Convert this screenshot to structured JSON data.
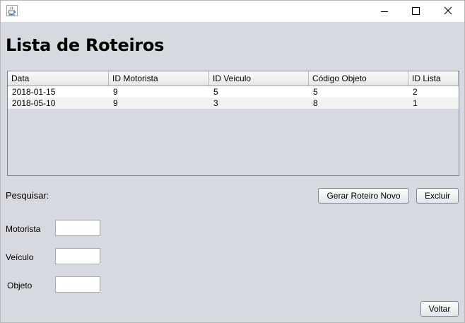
{
  "window": {
    "title": "",
    "app_icon": "java-coffee-cup-icon",
    "controls": [
      "minimize-icon",
      "maximize-icon",
      "close-icon"
    ]
  },
  "page_title": "Lista de Roteiros",
  "table": {
    "columns": [
      "Data",
      "ID Motorista",
      "ID Veiculo",
      "Código Objeto",
      "ID Lista"
    ],
    "rows": [
      [
        "2018-01-15",
        "9",
        "5",
        "5",
        "2"
      ],
      [
        "2018-05-10",
        "9",
        "3",
        "8",
        "1"
      ]
    ]
  },
  "search": {
    "label": "Pesquisar:",
    "fields": [
      {
        "label": "Motorista",
        "value": ""
      },
      {
        "label": "Veículo",
        "value": ""
      },
      {
        "label": "Objeto",
        "value": ""
      }
    ]
  },
  "buttons": {
    "new_route": "Gerar Roteiro Novo",
    "delete": "Excluir",
    "back": "Voltar"
  },
  "colors": {
    "panel_bg": "#d6d9df",
    "title_bar_bg": "#ffffff",
    "table_border": "#7a8a99"
  }
}
